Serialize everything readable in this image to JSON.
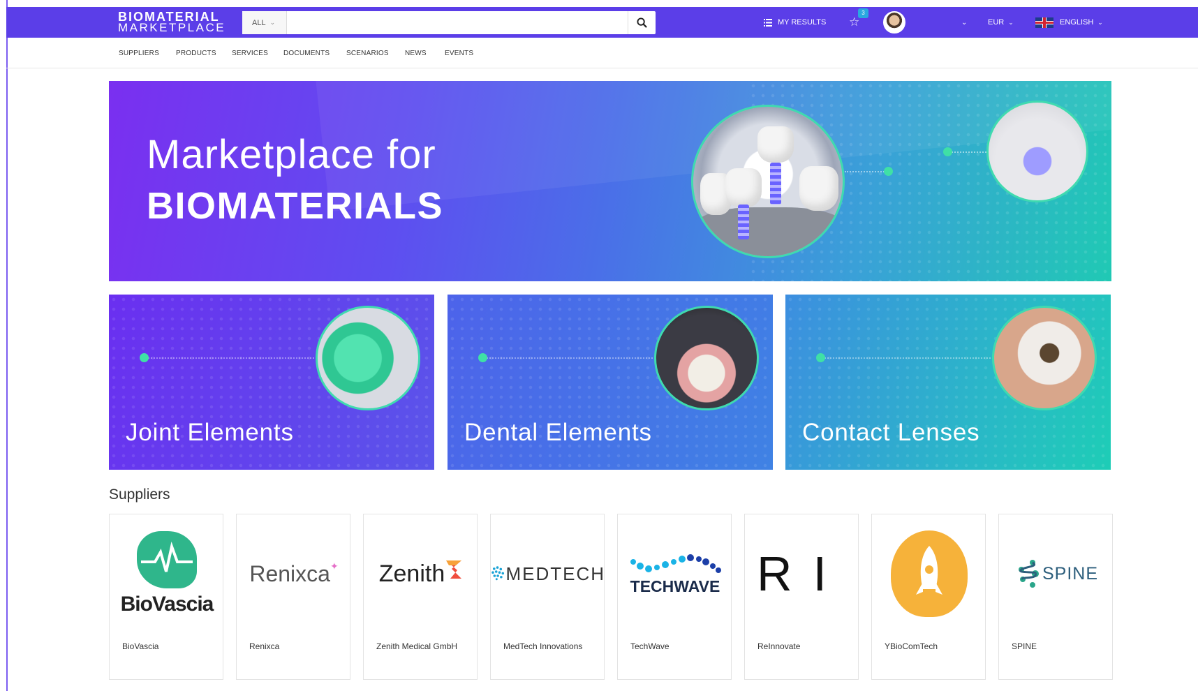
{
  "header": {
    "logo_line1": "BIOMATERIAL",
    "logo_line2": "MARKETPLACE",
    "search_scope": "ALL",
    "search_placeholder": "",
    "my_results": "MY RESULTS",
    "favorites_count": "3",
    "currency": "EUR",
    "language": "ENGLISH"
  },
  "nav": [
    "SUPPLIERS",
    "PRODUCTS",
    "SERVICES",
    "DOCUMENTS",
    "SCENARIOS",
    "NEWS",
    "EVENTS"
  ],
  "hero": {
    "line1": "Marketplace for",
    "line2": "BIOMATERIALS"
  },
  "categories": [
    {
      "title": "Joint Elements"
    },
    {
      "title": "Dental Elements"
    },
    {
      "title": "Contact Lenses"
    }
  ],
  "suppliers": {
    "heading": "Suppliers",
    "items": [
      {
        "name": "BioVascia",
        "logo_text": "BioVascia"
      },
      {
        "name": "Renixca",
        "logo_text": "Renixca"
      },
      {
        "name": "Zenith Medical GmbH",
        "logo_text": "Zenith"
      },
      {
        "name": "MedTech Innovations",
        "logo_text": "MEDTECH"
      },
      {
        "name": "TechWave",
        "logo_text": "TECHWAVE"
      },
      {
        "name": "ReInnovate",
        "logo_text": "RI"
      },
      {
        "name": "YBioComTech",
        "logo_text": ""
      },
      {
        "name": "SPINE",
        "logo_text": "SPINE"
      }
    ]
  },
  "colors": {
    "topbar": "#5b3ee8",
    "accent_dot": "#3fe0a6",
    "badge": "#29a8e0"
  }
}
